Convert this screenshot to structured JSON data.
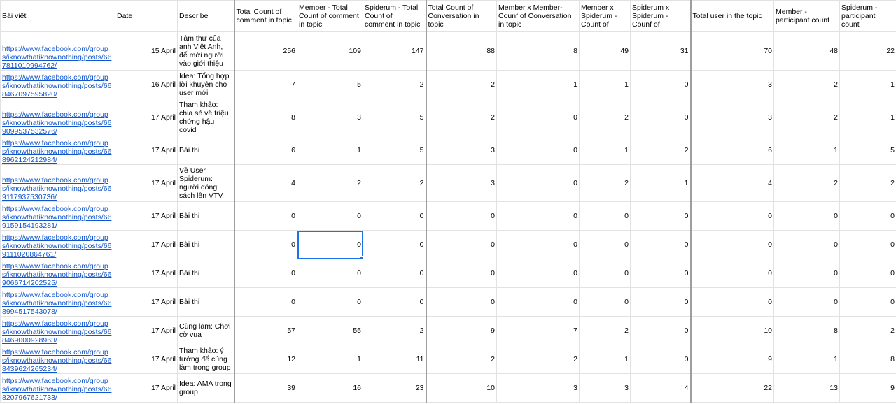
{
  "headers": [
    "Bài viết",
    "Date",
    "Describe",
    "Total Count of comment in topic",
    "Member - Total Count of comment in topic",
    "Spiderum - Total Count of comment in topic",
    "Total Count of Conversation in topic",
    "Member x Member- Counf of Conversation in topic",
    "Member x Spiderum - Count of",
    "Spiderum x Spiderum - Counf of",
    "Total user in the topic",
    "Member - participant count",
    "Spiderum - participant count"
  ],
  "rows": [
    {
      "link": "https://www.facebook.com/groups/iknowthatiknownothing/posts/667811010994762/",
      "date": "15 April",
      "desc": "Tâm thư của anh Việt Anh, để mời người vào giới thiệu",
      "nums": [
        "256",
        "109",
        "147",
        "88",
        "8",
        "49",
        "31",
        "70",
        "48",
        "22"
      ]
    },
    {
      "link": "https://www.facebook.com/groups/iknowthatiknownothing/posts/668467097595820/",
      "date": "16 April",
      "desc": "Idea: Tổng hợp lời khuyên cho user mới",
      "nums": [
        "7",
        "5",
        "2",
        "2",
        "1",
        "1",
        "0",
        "3",
        "2",
        "1"
      ]
    },
    {
      "link": "https://www.facebook.com/groups/iknowthatiknownothing/posts/669099537532576/",
      "date": "17 April",
      "desc": "Tham khảo: chia sẻ về triệu chứng hậu covid",
      "nums": [
        "8",
        "3",
        "5",
        "2",
        "0",
        "2",
        "0",
        "3",
        "2",
        "1"
      ]
    },
    {
      "link": "https://www.facebook.com/groups/iknowthatiknownothing/posts/668962124212984/",
      "date": "17 April",
      "desc": "Bài thi",
      "nums": [
        "6",
        "1",
        "5",
        "3",
        "0",
        "1",
        "2",
        "6",
        "1",
        "5"
      ]
    },
    {
      "link": "https://www.facebook.com/groups/iknowthatiknownothing/posts/669117937530736/",
      "date": "17 April",
      "desc": "Về User Spiderum: người đóng sách lên VTV",
      "nums": [
        "4",
        "2",
        "2",
        "3",
        "0",
        "2",
        "1",
        "4",
        "2",
        "2"
      ]
    },
    {
      "link": "https://www.facebook.com/groups/iknowthatiknownothing/posts/669159154193281/",
      "date": "17 April",
      "desc": "Bài thi",
      "nums": [
        "0",
        "0",
        "0",
        "0",
        "0",
        "0",
        "0",
        "0",
        "0",
        "0"
      ]
    },
    {
      "link": "https://www.facebook.com/groups/iknowthatiknownothing/posts/669111020864761/",
      "date": "17 April",
      "desc": "Bài thi",
      "nums": [
        "0",
        "0",
        "0",
        "0",
        "0",
        "0",
        "0",
        "0",
        "0",
        "0"
      ]
    },
    {
      "link": "https://www.facebook.com/groups/iknowthatiknownothing/posts/669066714202525/",
      "date": "17 April",
      "desc": "Bài thi",
      "nums": [
        "0",
        "0",
        "0",
        "0",
        "0",
        "0",
        "0",
        "0",
        "0",
        "0"
      ]
    },
    {
      "link": "https://www.facebook.com/groups/iknowthatiknownothing/posts/668994517543078/",
      "date": "17 April",
      "desc": "Bài thi",
      "nums": [
        "0",
        "0",
        "0",
        "0",
        "0",
        "0",
        "0",
        "0",
        "0",
        "0"
      ]
    },
    {
      "link": "https://www.facebook.com/groups/iknowthatiknownothing/posts/668469000928963/",
      "date": "17 April",
      "desc": "Cùng làm: Chơi cờ vua",
      "nums": [
        "57",
        "55",
        "2",
        "9",
        "7",
        "2",
        "0",
        "10",
        "8",
        "2"
      ]
    },
    {
      "link": "https://www.facebook.com/groups/iknowthatiknownothing/posts/668439624265234/",
      "date": "17 April",
      "desc": "Tham khảo: ý tưởng để cùng làm trong group",
      "nums": [
        "12",
        "1",
        "11",
        "2",
        "2",
        "1",
        "0",
        "9",
        "1",
        "8"
      ]
    },
    {
      "link": "https://www.facebook.com/groups/iknowthatiknownothing/posts/668207967621733/",
      "date": "17 April",
      "desc": "Idea: AMA trong group",
      "nums": [
        "39",
        "16",
        "23",
        "10",
        "3",
        "3",
        "4",
        "22",
        "13",
        "9"
      ]
    }
  ],
  "selected_cell": {
    "row": 6,
    "col": 4
  },
  "colors": {
    "link": "#1155cc",
    "selection": "#1a73e8",
    "grid": "#e2e2e2"
  }
}
